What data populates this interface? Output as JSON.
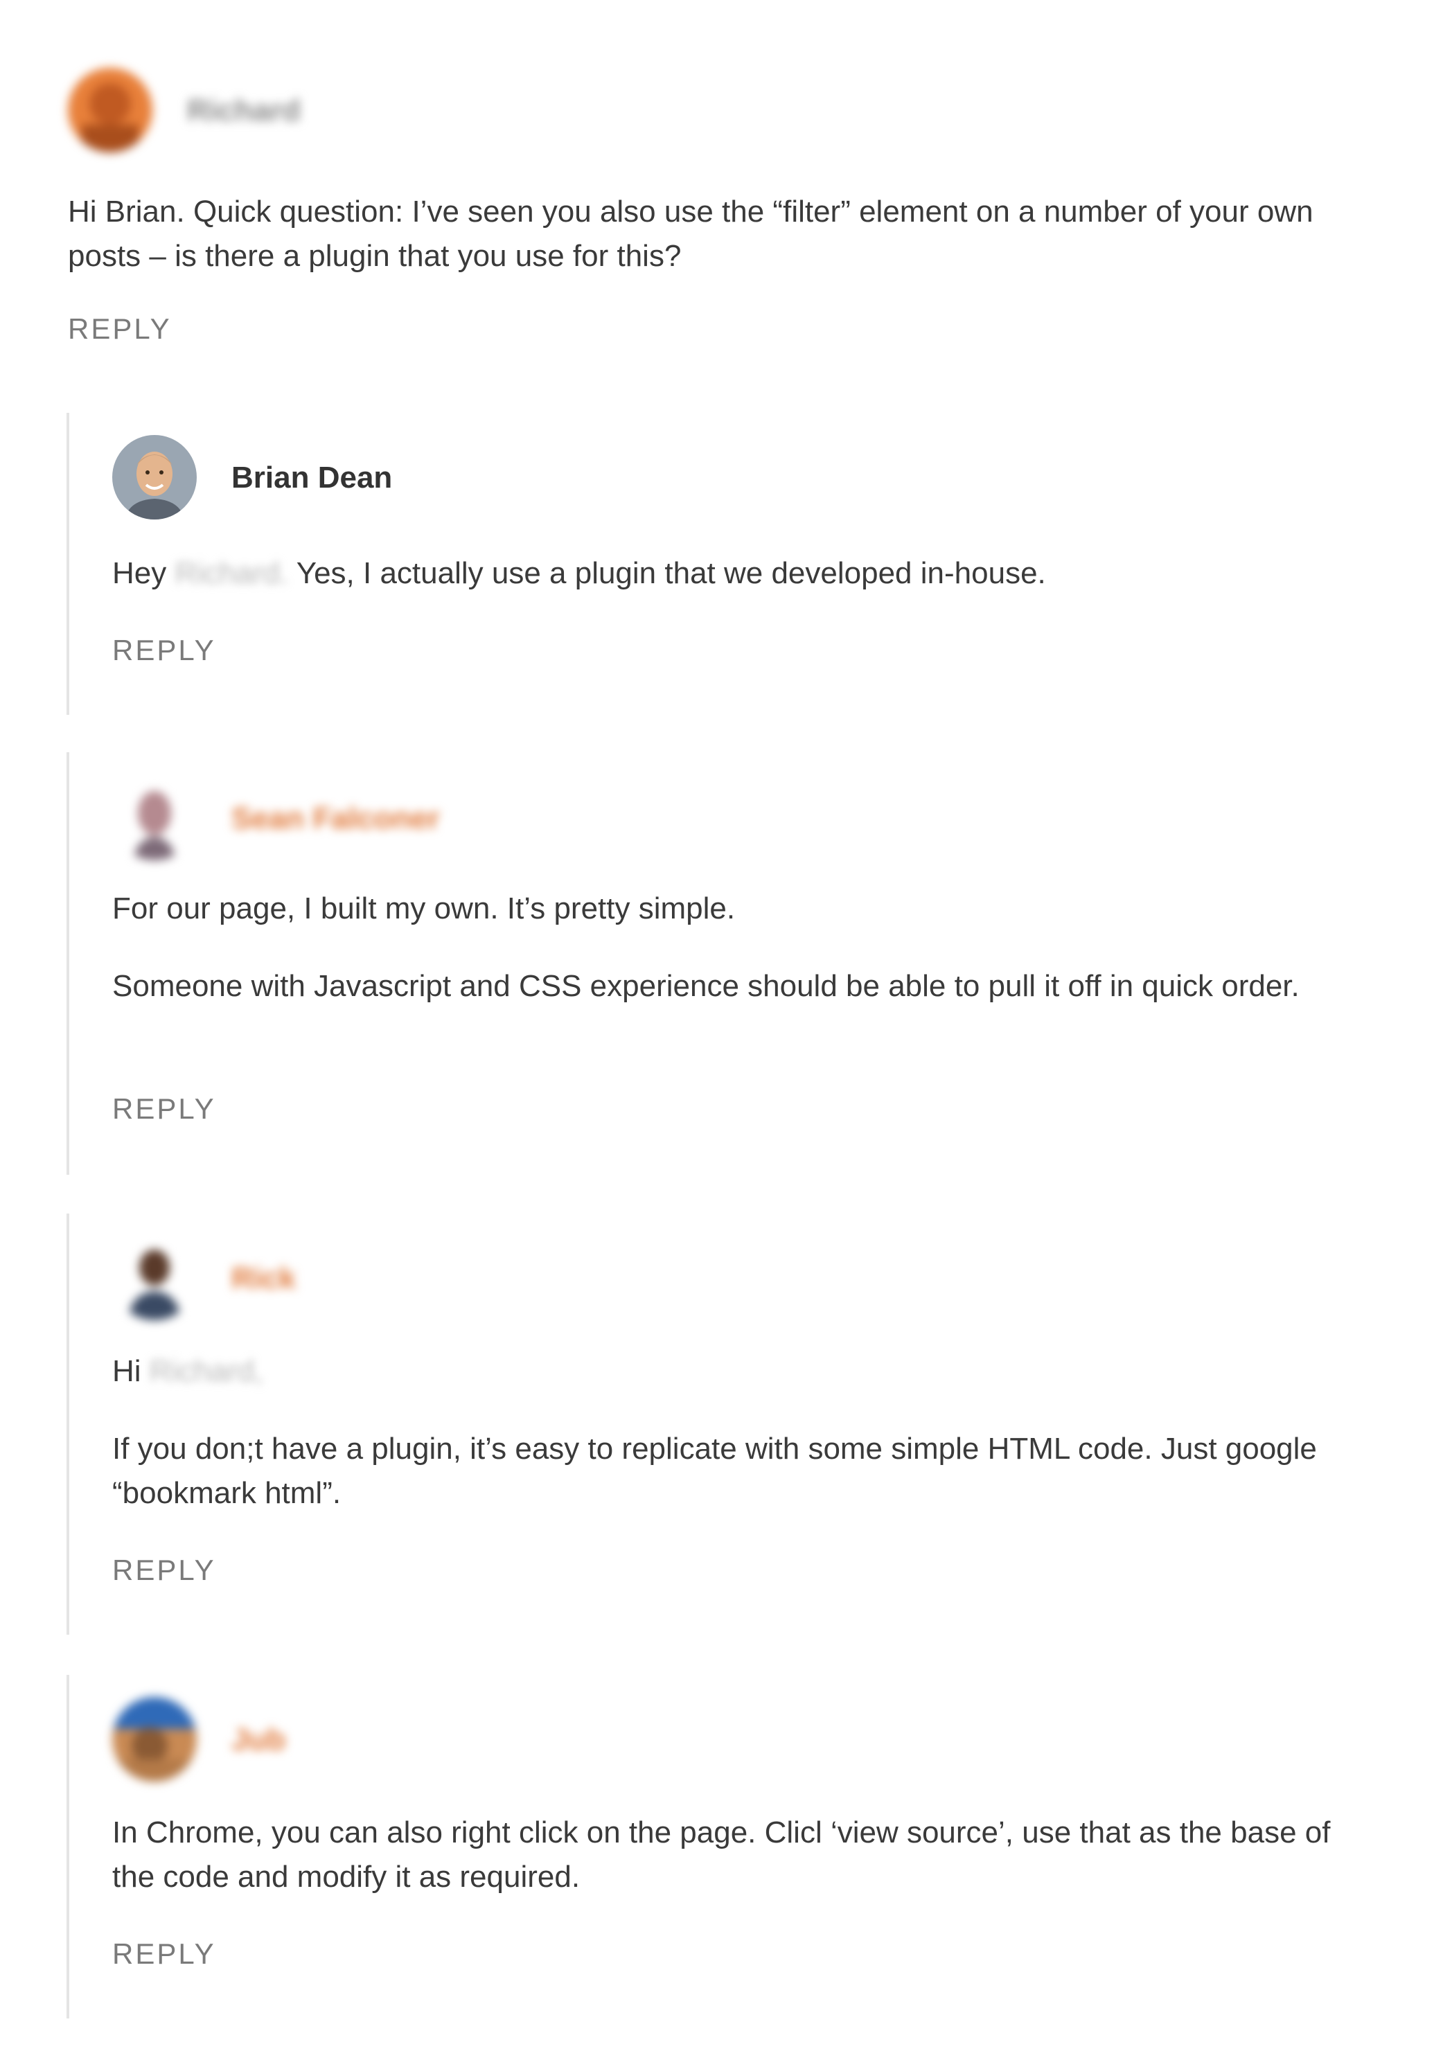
{
  "comments": [
    {
      "author": "Richard",
      "avatar_icon": "user-avatar-photo",
      "text": "Hi Brian. Quick question: I’ve seen you also use the “filter” element on a number of your own posts – is there a plugin that you use for this?",
      "reply_label": "REPLY"
    }
  ],
  "replies": [
    {
      "author": "Brian Dean",
      "avatar_icon": "user-avatar-photo",
      "text_before": "Hey",
      "redacted_name": "Richard.",
      "text_after": "Yes, I actually use a plugin that we developed in-house.",
      "reply_label": "REPLY"
    },
    {
      "author": "Sean Falconer",
      "avatar_icon": "user-avatar-photo",
      "paragraph1": "For our page, I built my own. It’s pretty simple.",
      "paragraph2": "Someone with Javascript and CSS experience should be able to pull it off in quick order.",
      "reply_label": "REPLY"
    },
    {
      "author": "Rick",
      "avatar_icon": "user-avatar-photo",
      "greeting": "Hi",
      "redacted_name": "Richard,",
      "paragraph2": "If you don;t have a plugin, it’s easy to replicate with some simple HTML code. Just google “bookmark html”.",
      "reply_label": "REPLY"
    },
    {
      "author": "Jub",
      "avatar_icon": "user-avatar-photo",
      "paragraph1": "In Chrome, you can also right click on the page. Clicl ‘view source’, use that as the base of the code and modify it as required.",
      "reply_label": "REPLY"
    }
  ],
  "colors": {
    "text": "#3a3a3a",
    "reply_link": "#7a7a7a",
    "thread_border": "#e4e4e4",
    "author_link": "#e07a3c"
  }
}
